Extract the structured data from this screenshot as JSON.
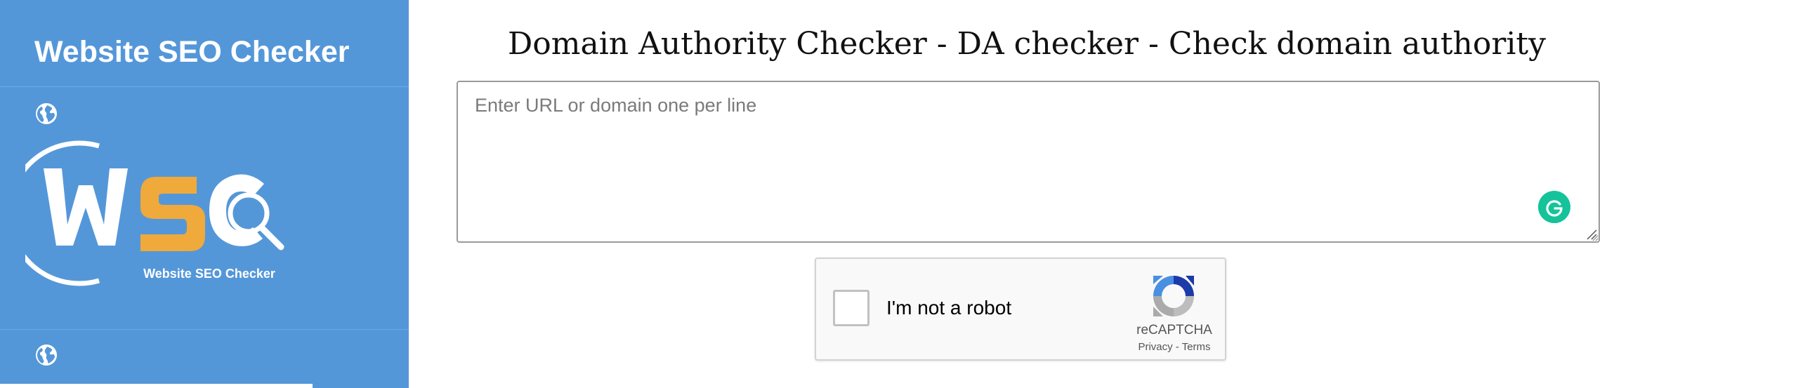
{
  "sidebar": {
    "brand_title": "Website SEO Checker",
    "logo_caption": "Website SEO Checker",
    "globe_icons": [
      "globe-icon",
      "globe-icon"
    ],
    "colors": {
      "background": "#5497d9",
      "logo_orange": "#f0a93b",
      "logo_white": "#ffffff"
    }
  },
  "main": {
    "title": "Domain Authority Checker - DA checker - Check domain authority",
    "url_input": {
      "placeholder": "Enter URL or domain one per line",
      "value": ""
    },
    "grammarly_icon": "grammarly-icon"
  },
  "recaptcha": {
    "label": "I'm not a robot",
    "brand": "reCAPTCHA",
    "privacy_link": "Privacy",
    "separator": "-",
    "terms_link": "Terms",
    "checked": false
  }
}
